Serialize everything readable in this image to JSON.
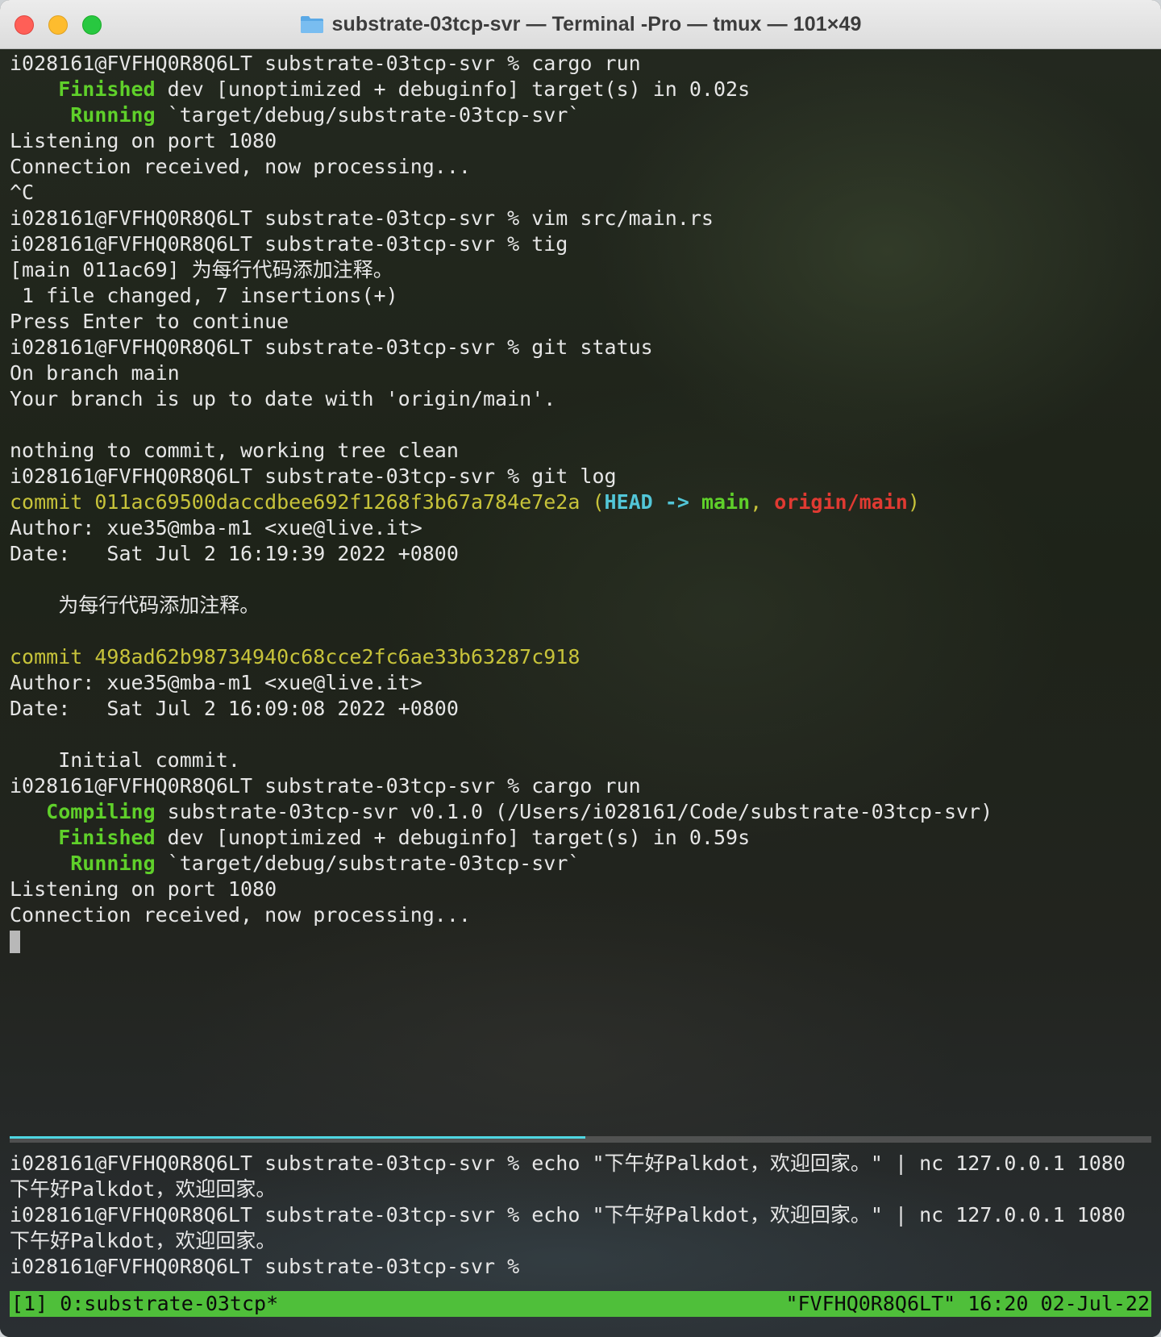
{
  "window": {
    "title": "substrate-03tcp-svr — Terminal -Pro — tmux — 101×49",
    "folder_icon": "folder-icon"
  },
  "top_pane": {
    "lines": [
      "i028161@FVFHQ0R8Q6LT substrate-03tcp-svr % cargo run",
      {
        "kw": "    Finished",
        "rest": " dev [unoptimized + debuginfo] target(s) in 0.02s"
      },
      {
        "kw": "     Running",
        "rest": " `target/debug/substrate-03tcp-svr`"
      },
      "Listening on port 1080",
      "Connection received, now processing...",
      "^C",
      "i028161@FVFHQ0R8Q6LT substrate-03tcp-svr % vim src/main.rs",
      "i028161@FVFHQ0R8Q6LT substrate-03tcp-svr % tig",
      "[main 011ac69] 为每行代码添加注释。",
      " 1 file changed, 7 insertions(+)",
      "Press Enter to continue",
      "i028161@FVFHQ0R8Q6LT substrate-03tcp-svr % git status",
      "On branch main",
      "Your branch is up to date with 'origin/main'.",
      "",
      "nothing to commit, working tree clean",
      "i028161@FVFHQ0R8Q6LT substrate-03tcp-svr % git log",
      {
        "commit": "commit 011ac69500daccdbee692f1268f3b67a784e7e2a",
        "refs_open": " (",
        "head": "HEAD -> ",
        "main": "main",
        "sep": ", ",
        "origin": "origin/main",
        "refs_close": ")"
      },
      "Author: xue35@mba-m1 <xue@live.it>",
      "Date:   Sat Jul 2 16:19:39 2022 +0800",
      "",
      "    为每行代码添加注释。",
      "",
      {
        "commit": "commit 498ad62b98734940c68cce2fc6ae33b63287c918"
      },
      "Author: xue35@mba-m1 <xue@live.it>",
      "Date:   Sat Jul 2 16:09:08 2022 +0800",
      "",
      "    Initial commit.",
      "i028161@FVFHQ0R8Q6LT substrate-03tcp-svr % cargo run",
      {
        "kw": "   Compiling",
        "rest": " substrate-03tcp-svr v0.1.0 (/Users/i028161/Code/substrate-03tcp-svr)"
      },
      {
        "kw": "    Finished",
        "rest": " dev [unoptimized + debuginfo] target(s) in 0.59s"
      },
      {
        "kw": "     Running",
        "rest": " `target/debug/substrate-03tcp-svr`"
      },
      "Listening on port 1080",
      "Connection received, now processing..."
    ]
  },
  "bottom_pane": {
    "lines": [
      "i028161@FVFHQ0R8Q6LT substrate-03tcp-svr % echo \"下午好Palkdot，欢迎回家。\" | nc 127.0.0.1 1080",
      "下午好Palkdot，欢迎回家。",
      "i028161@FVFHQ0R8Q6LT substrate-03tcp-svr % echo \"下午好Palkdot，欢迎回家。\" | nc 127.0.0.1 1080",
      "下午好Palkdot，欢迎回家。",
      "i028161@FVFHQ0R8Q6LT substrate-03tcp-svr %"
    ]
  },
  "status_bar": {
    "left": "[1] 0:substrate-03tcp*",
    "right": "\"FVFHQ0R8Q6LT\" 16:20 02-Jul-22"
  },
  "colors": {
    "keyword_green": "#5fd02a",
    "commit_yellow": "#c7c33a",
    "head_cyan": "#52c6d8",
    "origin_red": "#e03a32",
    "status_green": "#4fbf3a",
    "active_pane_cyan": "#4fd6e2"
  }
}
